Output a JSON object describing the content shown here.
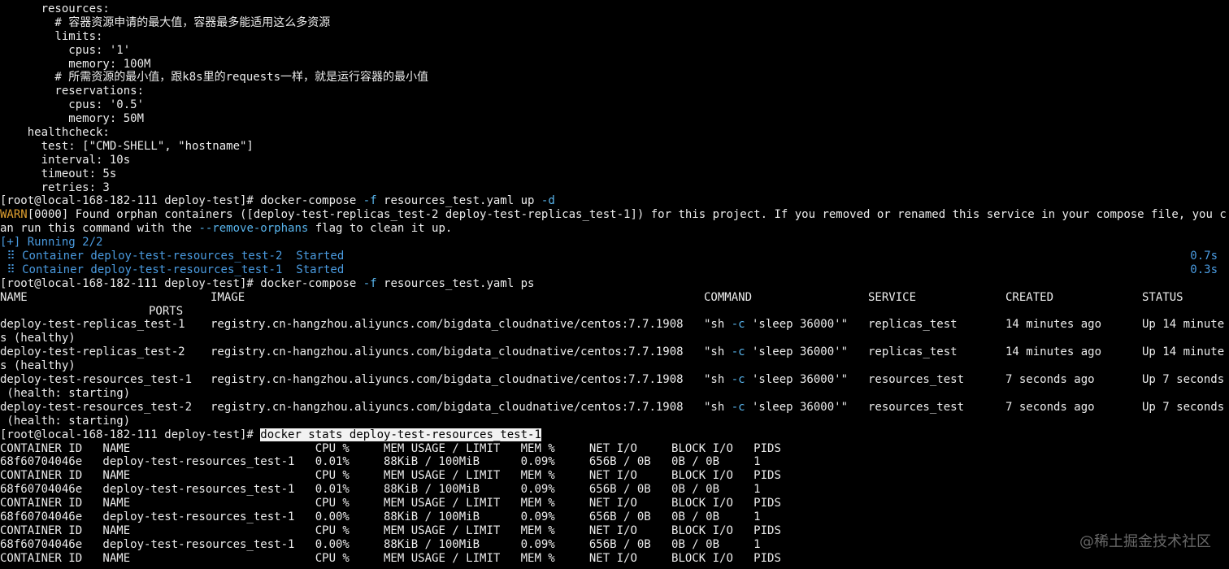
{
  "yaml": [
    "      resources:",
    "        # 容器资源申请的最大值，容器最多能适用这么多资源",
    "        limits:",
    "          cpus: '1'",
    "          memory: 100M",
    "        # 所需资源的最小值，跟k8s里的requests一样，就是运行容器的最小值",
    "        reservations:",
    "          cpus: '0.5'",
    "          memory: 50M",
    "    healthcheck:",
    "      test: [\"CMD-SHELL\", \"hostname\"]",
    "      interval: 10s",
    "      timeout: 5s",
    "      retries: 3"
  ],
  "prompt": "[root@local-168-182-111 deploy-test]# ",
  "cmd_up": {
    "pre": "docker-compose ",
    "flag": "-f",
    "post": " resources_test.yaml up ",
    "flag2": "-d"
  },
  "warn": {
    "tag": "WARN",
    "line1_rest": "[0000] Found orphan containers ([deploy-test-replicas_test-2 deploy-test-replicas_test-1]) for this project. If you removed or renamed this service in your compose file, you c",
    "line2_pre": "an run this command with the ",
    "line2_flag": "--remove-orphans",
    "line2_post": " flag to clean it up."
  },
  "running": "[+] Running 2/2",
  "containers_started": [
    {
      "text": " ⠿ Container deploy-test-resources_test-2  Started",
      "time": "0.7s"
    },
    {
      "text": " ⠿ Container deploy-test-resources_test-1  Started",
      "time": "0.3s"
    }
  ],
  "cmd_ps": {
    "pre": "docker-compose ",
    "flag": "-f",
    "post": " resources_test.yaml ps"
  },
  "ps_header": {
    "name": "NAME",
    "image": "IMAGE",
    "command": "COMMAND",
    "service": "SERVICE",
    "created": "CREATED",
    "status": "STATUS",
    "ports": "PORTS"
  },
  "ps_rows": [
    {
      "name": "deploy-test-replicas_test-1",
      "image": "registry.cn-hangzhou.aliyuncs.com/bigdata_cloudnative/centos:7.7.1908",
      "cmd_pre": "\"sh ",
      "cmd_flag": "-c",
      "cmd_post": " 'sleep 36000'\"",
      "service": "replicas_test",
      "created": "14 minutes ago",
      "status": "Up 14 minute",
      "wrap": "s (healthy)"
    },
    {
      "name": "deploy-test-replicas_test-2",
      "image": "registry.cn-hangzhou.aliyuncs.com/bigdata_cloudnative/centos:7.7.1908",
      "cmd_pre": "\"sh ",
      "cmd_flag": "-c",
      "cmd_post": " 'sleep 36000'\"",
      "service": "replicas_test",
      "created": "14 minutes ago",
      "status": "Up 14 minute",
      "wrap": "s (healthy)"
    },
    {
      "name": "deploy-test-resources_test-1",
      "image": "registry.cn-hangzhou.aliyuncs.com/bigdata_cloudnative/centos:7.7.1908",
      "cmd_pre": "\"sh ",
      "cmd_flag": "-c",
      "cmd_post": " 'sleep 36000'\"",
      "service": "resources_test",
      "created": "7 seconds ago",
      "status": "Up 7 seconds",
      "wrap": " (health: starting)"
    },
    {
      "name": "deploy-test-resources_test-2",
      "image": "registry.cn-hangzhou.aliyuncs.com/bigdata_cloudnative/centos:7.7.1908",
      "cmd_pre": "\"sh ",
      "cmd_flag": "-c",
      "cmd_post": " 'sleep 36000'\"",
      "service": "resources_test",
      "created": "7 seconds ago",
      "status": "Up 7 seconds",
      "wrap": " (health: starting)"
    }
  ],
  "cmd_stats": "docker stats deploy-test-resources_test-1",
  "stats_header": "CONTAINER ID   NAME                           CPU %     MEM USAGE / LIMIT   MEM %     NET I/O     BLOCK I/O   PIDS",
  "stats_rows": [
    "68f60704046e   deploy-test-resources_test-1   0.01%     88KiB / 100MiB      0.09%     656B / 0B   0B / 0B     1",
    "68f60704046e   deploy-test-resources_test-1   0.01%     88KiB / 100MiB      0.09%     656B / 0B   0B / 0B     1",
    "68f60704046e   deploy-test-resources_test-1   0.00%     88KiB / 100MiB      0.09%     656B / 0B   0B / 0B     1",
    "68f60704046e   deploy-test-resources_test-1   0.00%     88KiB / 100MiB      0.09%     656B / 0B   0B / 0B     1"
  ],
  "watermark": "@稀土掘金技术社区",
  "colors": {
    "background": "#000000",
    "foreground": "#ececec",
    "warn": "#e0a030",
    "info_blue": "#4a9be0",
    "flag_blue": "#58b4ec",
    "selection_bg": "#f2f2f2"
  }
}
